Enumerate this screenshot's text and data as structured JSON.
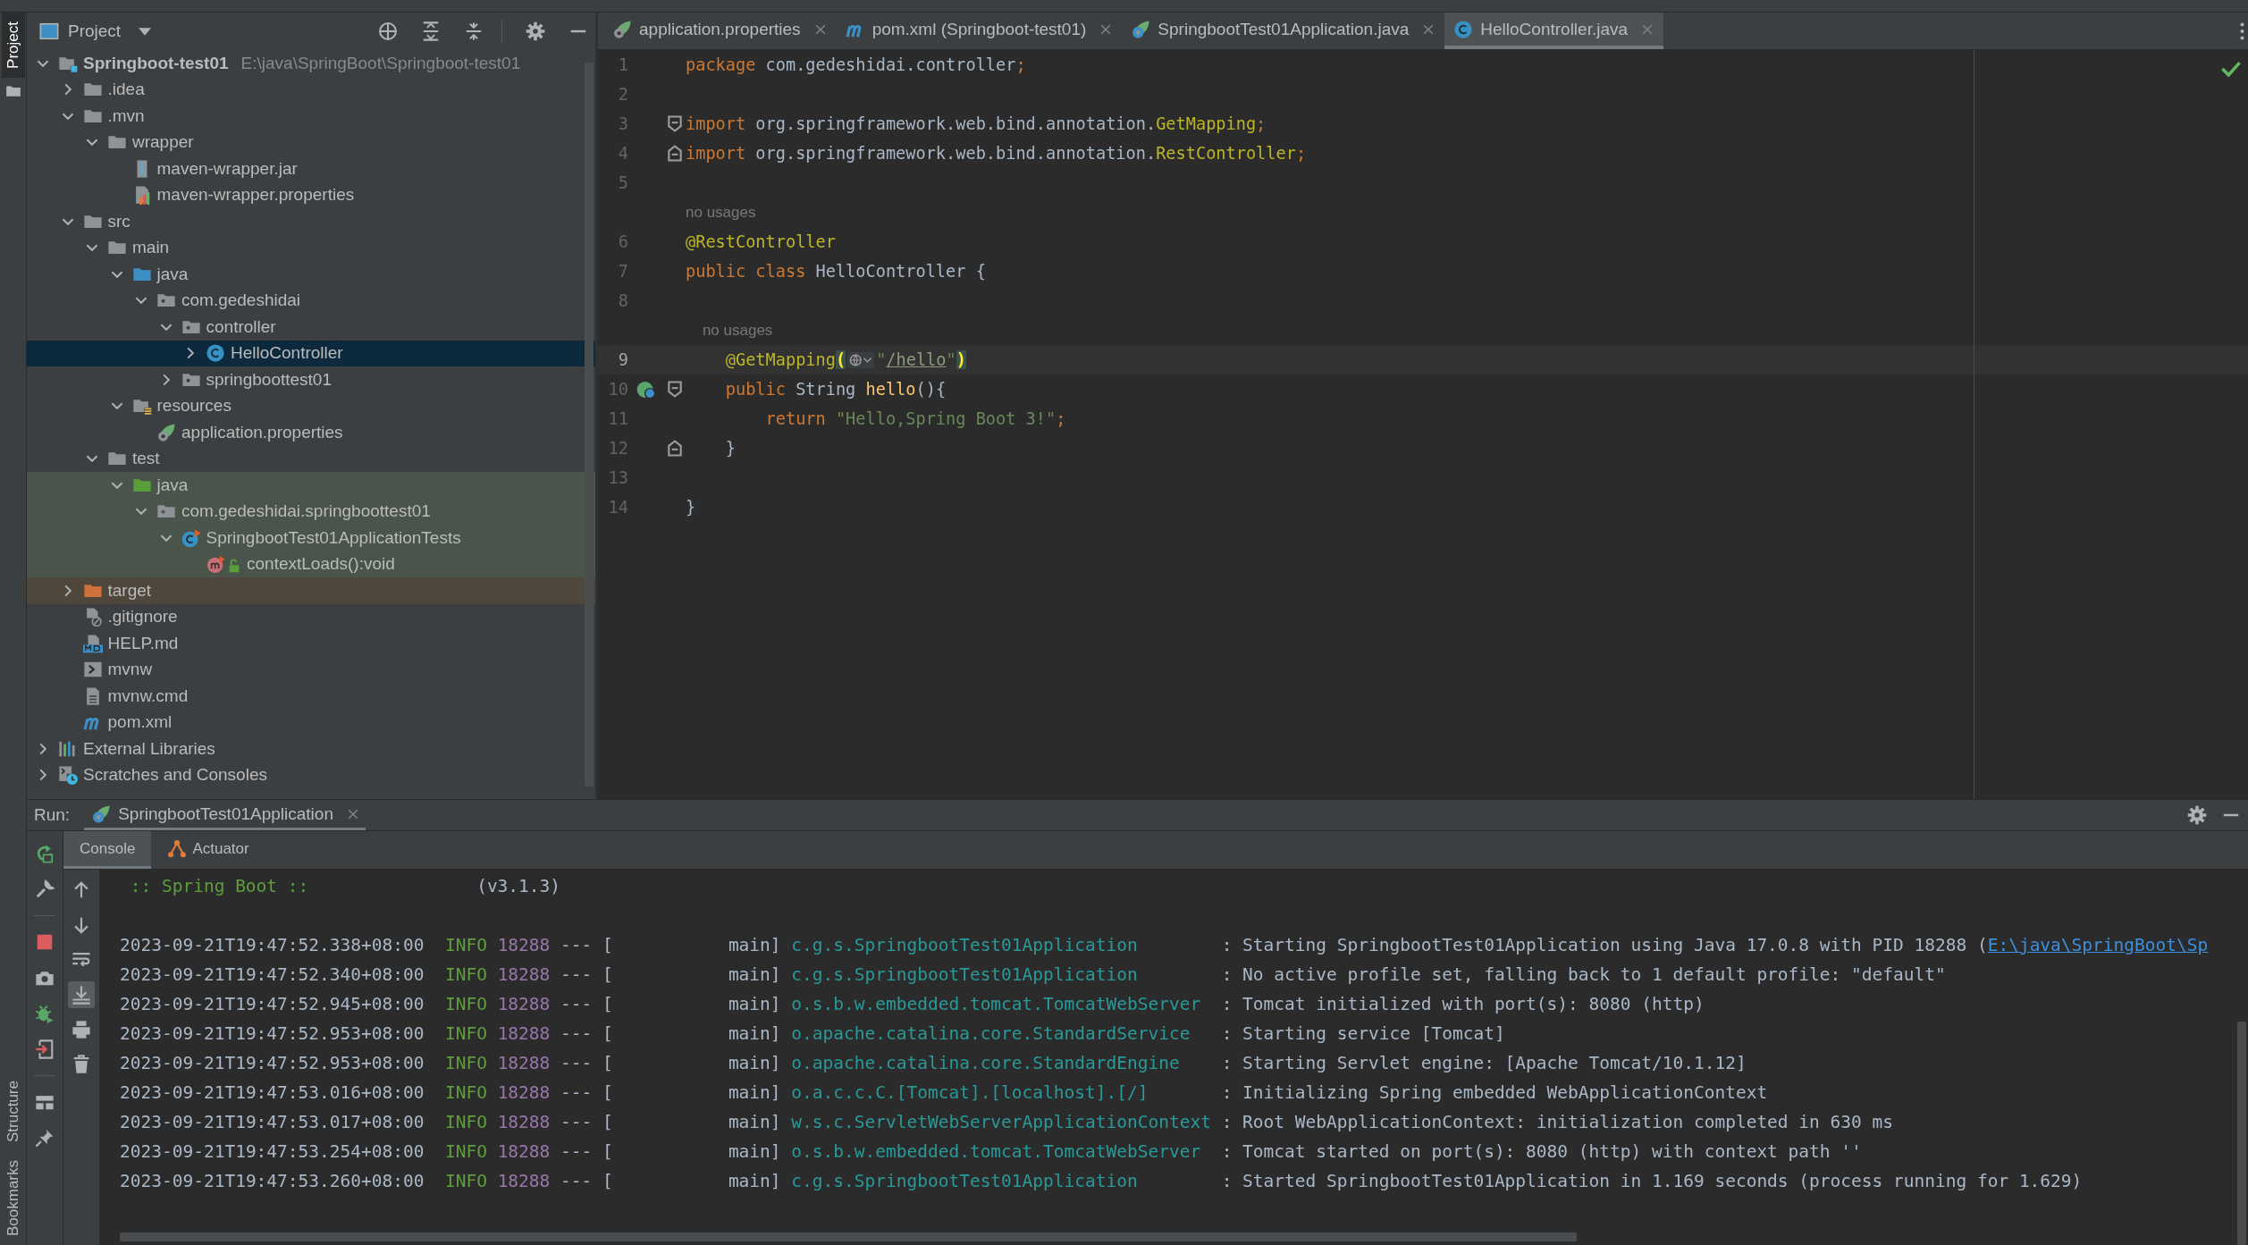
{
  "tool_stripe": {
    "top": [
      {
        "label": "Project",
        "selected": true
      }
    ],
    "bottom": [
      {
        "label": "Structure",
        "selected": false
      },
      {
        "label": "Bookmarks",
        "selected": false
      }
    ]
  },
  "project_panel": {
    "title": "Project",
    "tree": [
      {
        "label": "Springboot-test01",
        "path": "E:\\java\\SpringBoot\\Springboot-test01",
        "kind": "module-folder",
        "expanded": true,
        "selected": false,
        "children": [
          {
            "label": ".idea",
            "kind": "folder",
            "expanded": false,
            "selected": false
          },
          {
            "label": ".mvn",
            "kind": "folder",
            "expanded": true,
            "selected": false,
            "children": [
              {
                "label": "wrapper",
                "kind": "folder",
                "expanded": true,
                "selected": false,
                "children": [
                  {
                    "label": "maven-wrapper.jar",
                    "kind": "jar",
                    "selected": false
                  },
                  {
                    "label": "maven-wrapper.properties",
                    "kind": "properties",
                    "selected": false
                  }
                ]
              }
            ]
          },
          {
            "label": "src",
            "kind": "folder",
            "expanded": true,
            "selected": false,
            "children": [
              {
                "label": "main",
                "kind": "folder",
                "expanded": true,
                "selected": false,
                "children": [
                  {
                    "label": "java",
                    "kind": "sources",
                    "expanded": true,
                    "selected": false,
                    "children": [
                      {
                        "label": "com.gedeshidai",
                        "kind": "package",
                        "expanded": true,
                        "selected": false,
                        "children": [
                          {
                            "label": "controller",
                            "kind": "package",
                            "expanded": true,
                            "selected": false,
                            "children": [
                              {
                                "label": "HelloController",
                                "kind": "class",
                                "expanded": false,
                                "selected": true
                              }
                            ]
                          },
                          {
                            "label": "springboottest01",
                            "kind": "package",
                            "expanded": false,
                            "selected": false
                          }
                        ]
                      }
                    ]
                  },
                  {
                    "label": "resources",
                    "kind": "resources",
                    "expanded": true,
                    "selected": false,
                    "children": [
                      {
                        "label": "application.properties",
                        "kind": "spring",
                        "selected": false
                      }
                    ]
                  }
                ]
              },
              {
                "label": "test",
                "kind": "folder",
                "expanded": true,
                "selected": false,
                "children": [
                  {
                    "label": "java",
                    "kind": "tests",
                    "expanded": true,
                    "selected": false,
                    "color": "#49544a",
                    "children": [
                      {
                        "label": "com.gedeshidai.springboottest01",
                        "kind": "package",
                        "expanded": true,
                        "selected": false,
                        "color": "#49544a",
                        "children": [
                          {
                            "label": "SpringbootTest01ApplicationTests",
                            "kind": "testclass",
                            "expanded": true,
                            "selected": false,
                            "color": "#49544a",
                            "children": [
                              {
                                "label": "contextLoads():void",
                                "kind": "method",
                                "selected": false,
                                "color": "#49544a"
                              }
                            ]
                          }
                        ]
                      }
                    ]
                  }
                ]
              }
            ]
          },
          {
            "label": "target",
            "kind": "excluded",
            "expanded": false,
            "selected": false,
            "color": "#4f473b"
          },
          {
            "label": ".gitignore",
            "kind": "ignore",
            "selected": false
          },
          {
            "label": "HELP.md",
            "kind": "markdown",
            "selected": false
          },
          {
            "label": "mvnw",
            "kind": "shell",
            "selected": false
          },
          {
            "label": "mvnw.cmd",
            "kind": "text",
            "selected": false
          },
          {
            "label": "pom.xml",
            "kind": "maven",
            "selected": false
          }
        ]
      },
      {
        "label": "External Libraries",
        "kind": "libraries",
        "expanded": false,
        "selected": false
      },
      {
        "label": "Scratches and Consoles",
        "kind": "scratches",
        "expanded": false,
        "selected": false
      }
    ]
  },
  "editor": {
    "tabs": [
      {
        "label": "application.properties",
        "kind": "spring",
        "selected": false
      },
      {
        "label": "pom.xml (Springboot-test01)",
        "kind": "maven",
        "selected": false
      },
      {
        "label": "SpringbootTest01Application.java",
        "kind": "app",
        "selected": false
      },
      {
        "label": "HelloController.java",
        "kind": "class",
        "selected": true
      }
    ],
    "lines": [
      {
        "kind": "code",
        "number": "1",
        "current": false,
        "fold_start": false,
        "fold_end": false,
        "bean": false,
        "tokens": [
          {
            "text": "package",
            "kind": "keyword"
          },
          {
            "text": " com.gedeshidai.controller",
            "kind": "plain"
          },
          {
            "text": ";",
            "kind": "keyword"
          }
        ]
      },
      {
        "kind": "code",
        "number": "2",
        "current": false,
        "fold_start": false,
        "fold_end": false,
        "bean": false
      },
      {
        "kind": "code",
        "number": "3",
        "current": false,
        "fold_start": true,
        "fold_end": false,
        "bean": false,
        "tokens": [
          {
            "text": "import",
            "kind": "keyword"
          },
          {
            "text": " org.springframework.web.bind.annotation.",
            "kind": "plain"
          },
          {
            "text": "GetMapping",
            "kind": "annotation"
          },
          {
            "text": ";",
            "kind": "keyword"
          }
        ]
      },
      {
        "kind": "code",
        "number": "4",
        "current": false,
        "fold_start": false,
        "fold_end": true,
        "bean": false,
        "tokens": [
          {
            "text": "import",
            "kind": "keyword"
          },
          {
            "text": " org.springframework.web.bind.annotation.",
            "kind": "plain"
          },
          {
            "text": "RestController",
            "kind": "annotation"
          },
          {
            "text": ";",
            "kind": "keyword"
          }
        ]
      },
      {
        "kind": "code",
        "number": "5",
        "current": false,
        "fold_start": false,
        "fold_end": false,
        "bean": false
      },
      {
        "kind": "hint",
        "text": "no usages"
      },
      {
        "kind": "code",
        "number": "6",
        "current": false,
        "fold_start": false,
        "fold_end": false,
        "bean": false,
        "tokens": [
          {
            "text": "@RestController",
            "kind": "annotation"
          }
        ]
      },
      {
        "kind": "code",
        "number": "7",
        "current": false,
        "fold_start": false,
        "fold_end": false,
        "bean": false,
        "tokens": [
          {
            "text": "public class ",
            "kind": "keyword"
          },
          {
            "text": "HelloController {",
            "kind": "plain"
          }
        ]
      },
      {
        "kind": "code",
        "number": "8",
        "current": false,
        "fold_start": false,
        "fold_end": false,
        "bean": false
      },
      {
        "kind": "hint",
        "text": "    no usages"
      },
      {
        "kind": "code",
        "number": "9",
        "current": true,
        "fold_start": false,
        "fold_end": false,
        "bean": false,
        "tokens": [
          {
            "text": "    @GetMapping",
            "kind": "annotation"
          },
          {
            "text": "(",
            "kind": "paren-match"
          },
          {
            "kind": "inlay"
          },
          {
            "text": "\"",
            "kind": "string"
          },
          {
            "text": "/hello",
            "kind": "url"
          },
          {
            "text": "\"",
            "kind": "string"
          },
          {
            "text": ")",
            "kind": "paren-match"
          }
        ]
      },
      {
        "kind": "code",
        "number": "10",
        "current": false,
        "fold_start": true,
        "fold_end": false,
        "bean": true,
        "tokens": [
          {
            "text": "    public ",
            "kind": "keyword"
          },
          {
            "text": "String ",
            "kind": "plain"
          },
          {
            "text": "hello",
            "kind": "method"
          },
          {
            "text": "(){",
            "kind": "plain"
          }
        ]
      },
      {
        "kind": "code",
        "number": "11",
        "current": false,
        "fold_start": false,
        "fold_end": false,
        "bean": false,
        "tokens": [
          {
            "text": "        return ",
            "kind": "keyword"
          },
          {
            "text": "\"Hello,Spring Boot 3!\"",
            "kind": "string"
          },
          {
            "text": ";",
            "kind": "keyword"
          }
        ]
      },
      {
        "kind": "code",
        "number": "12",
        "current": false,
        "fold_start": false,
        "fold_end": true,
        "bean": false,
        "tokens": [
          {
            "text": "    }",
            "kind": "plain"
          }
        ]
      },
      {
        "kind": "code",
        "number": "13",
        "current": false,
        "fold_start": false,
        "fold_end": false,
        "bean": false
      },
      {
        "kind": "code",
        "number": "14",
        "current": false,
        "fold_start": false,
        "fold_end": false,
        "bean": false,
        "tokens": [
          {
            "text": "}",
            "kind": "plain"
          }
        ]
      }
    ]
  },
  "run_panel": {
    "label": "Run:",
    "tabs": [
      {
        "label": "SpringbootTest01Application",
        "selected": true
      }
    ],
    "subtabs": [
      {
        "label": "Console",
        "kind": "console",
        "selected": true
      },
      {
        "label": "Actuator",
        "kind": "actuator",
        "selected": false
      }
    ],
    "run_toolbar": [
      {
        "kind": "rerun"
      },
      {
        "kind": "wrench"
      },
      {
        "kind": "separator"
      },
      {
        "kind": "stop"
      },
      {
        "kind": "camera"
      },
      {
        "kind": "bug"
      },
      {
        "kind": "exit"
      },
      {
        "kind": "separator"
      },
      {
        "kind": "layout"
      },
      {
        "kind": "pin"
      }
    ],
    "console_toolbar": [
      {
        "kind": "up",
        "on": false
      },
      {
        "kind": "down",
        "on": false
      },
      {
        "kind": "wrap",
        "on": false
      },
      {
        "kind": "scroll-end",
        "on": true
      },
      {
        "kind": "print",
        "on": false
      },
      {
        "kind": "trash",
        "on": false
      }
    ],
    "console": {
      "banner": {
        "title": ":: Spring Boot ::",
        "version": "(v3.1.3)"
      },
      "log": [
        {
          "time": "2023-09-21T19:47:52.338+08:00",
          "level": "INFO",
          "pid": "18288",
          "sep": "--- [",
          "thread": "main]",
          "logger": "c.g.s.SpringbootTest01Application",
          "message": ": Starting SpringbootTest01Application using Java 17.0.8 with PID 18288 (",
          "link": "E:\\java\\SpringBoot\\Sp"
        },
        {
          "time": "2023-09-21T19:47:52.340+08:00",
          "level": "INFO",
          "pid": "18288",
          "sep": "--- [",
          "thread": "main]",
          "logger": "c.g.s.SpringbootTest01Application",
          "message": ": No active profile set, falling back to 1 default profile: \"default\""
        },
        {
          "time": "2023-09-21T19:47:52.945+08:00",
          "level": "INFO",
          "pid": "18288",
          "sep": "--- [",
          "thread": "main]",
          "logger": "o.s.b.w.embedded.tomcat.TomcatWebServer",
          "message": ": Tomcat initialized with port(s): 8080 (http)"
        },
        {
          "time": "2023-09-21T19:47:52.953+08:00",
          "level": "INFO",
          "pid": "18288",
          "sep": "--- [",
          "thread": "main]",
          "logger": "o.apache.catalina.core.StandardService",
          "message": ": Starting service [Tomcat]"
        },
        {
          "time": "2023-09-21T19:47:52.953+08:00",
          "level": "INFO",
          "pid": "18288",
          "sep": "--- [",
          "thread": "main]",
          "logger": "o.apache.catalina.core.StandardEngine",
          "message": ": Starting Servlet engine: [Apache Tomcat/10.1.12]"
        },
        {
          "time": "2023-09-21T19:47:53.016+08:00",
          "level": "INFO",
          "pid": "18288",
          "sep": "--- [",
          "thread": "main]",
          "logger": "o.a.c.c.C.[Tomcat].[localhost].[/]",
          "message": ": Initializing Spring embedded WebApplicationContext"
        },
        {
          "time": "2023-09-21T19:47:53.017+08:00",
          "level": "INFO",
          "pid": "18288",
          "sep": "--- [",
          "thread": "main]",
          "logger": "w.s.c.ServletWebServerApplicationContext",
          "message": ": Root WebApplicationContext: initialization completed in 630 ms"
        },
        {
          "time": "2023-09-21T19:47:53.254+08:00",
          "level": "INFO",
          "pid": "18288",
          "sep": "--- [",
          "thread": "main]",
          "logger": "o.s.b.w.embedded.tomcat.TomcatWebServer",
          "message": ": Tomcat started on port(s): 8080 (http) with context path ''"
        },
        {
          "time": "2023-09-21T19:47:53.260+08:00",
          "level": "INFO",
          "pid": "18288",
          "sep": "--- [",
          "thread": "main]",
          "logger": "c.g.s.SpringbootTest01Application",
          "message": ": Started SpringbootTest01Application in 1.169 seconds (process running for 1.629)"
        }
      ]
    }
  }
}
